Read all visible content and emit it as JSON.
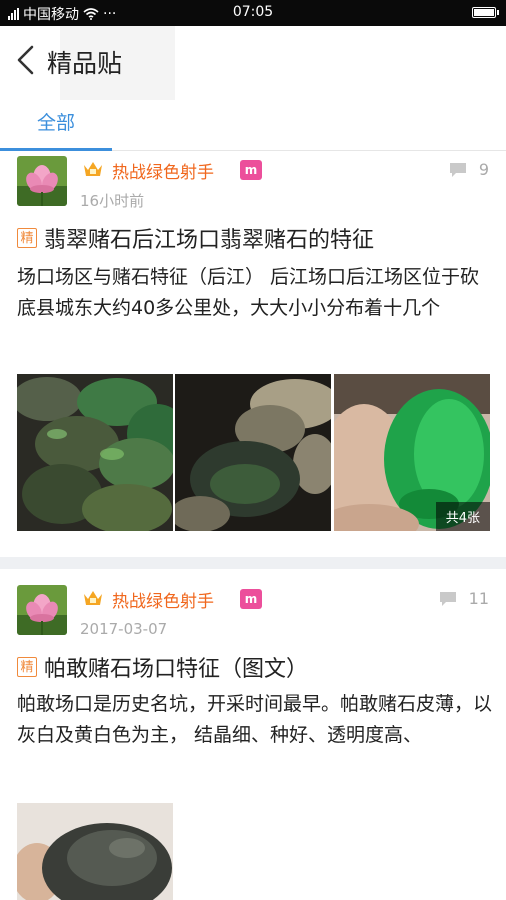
{
  "status_bar": {
    "carrier": "中国移动",
    "time": "07:05",
    "more": "···"
  },
  "header": {
    "title": "精品贴"
  },
  "tabs": [
    {
      "label": "全部"
    }
  ],
  "posts": [
    {
      "author": "热战绿色射手",
      "level_badge": "m",
      "time": "16小时前",
      "comments": "9",
      "tag": "精",
      "title": "翡翠赌石后江场口翡翠赌石的特征",
      "excerpt": "场口场区与赌石特征（后江） 后江场口后江场区位于砍底县城东大约40多公里处，大大小小分布着十几个",
      "image_count_label": "共4张"
    },
    {
      "author": "热战绿色射手",
      "level_badge": "m",
      "time": "2017-03-07",
      "comments": "11",
      "tag": "精",
      "title": "帕敢赌石场口特征（图文）",
      "excerpt": "帕敢场口是历史名坑，开采时间最早。帕敢赌石皮薄，以灰白及黄白色为主， 结晶细、种好、透明度高、"
    }
  ],
  "colors": {
    "accent": "#3c8fdc",
    "author": "#f0671d",
    "level": "#ec4f9b",
    "tag": "#f08a3c"
  }
}
